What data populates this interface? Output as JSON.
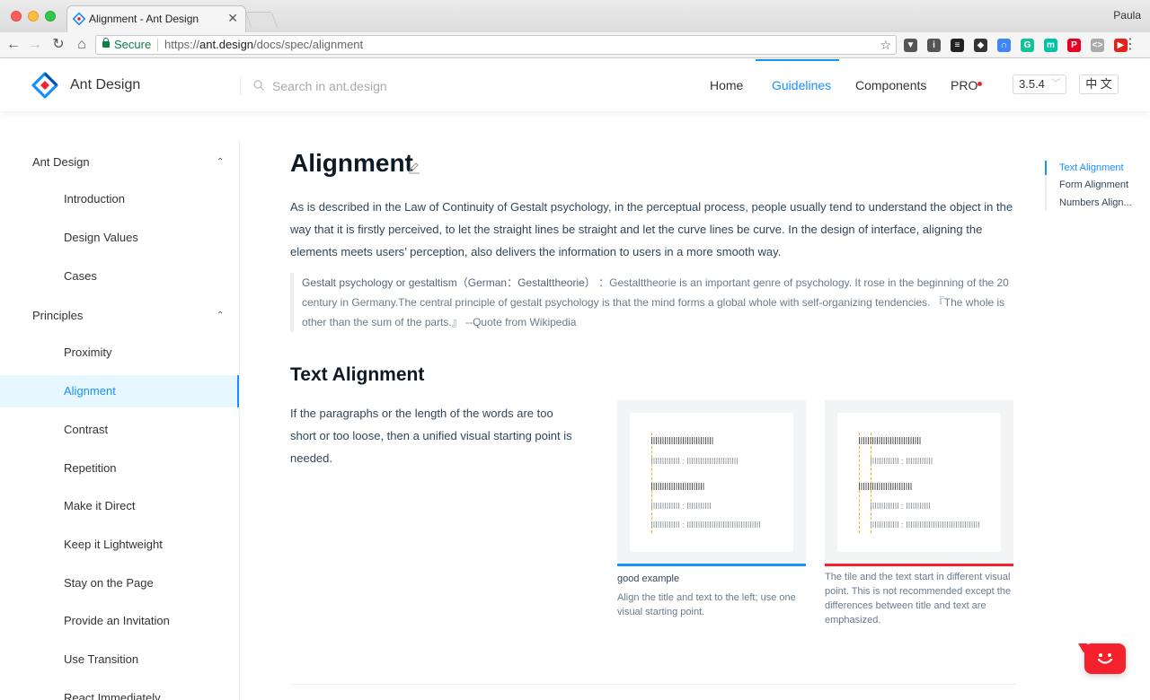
{
  "browser": {
    "tab_title": "Alignment - Ant Design",
    "tab_close": "✕",
    "profile": "Paula",
    "secure_label": "Secure",
    "url_scheme": "https://",
    "url_host": "ant.design",
    "url_path": "/docs/spec/alignment",
    "bookmark_star": "☆",
    "back": "←",
    "forward": "→",
    "reload": "↻",
    "home": "⌂",
    "menu": "⋮",
    "extensions": [
      {
        "name": "pocket-icon",
        "color": "#555555",
        "glyph": "▼"
      },
      {
        "name": "info-icon",
        "color": "#555555",
        "glyph": "i"
      },
      {
        "name": "buffer-icon",
        "color": "#222222",
        "glyph": "≡"
      },
      {
        "name": "shield-icon",
        "color": "#333333",
        "glyph": "◆"
      },
      {
        "name": "rainbow-icon",
        "color": "#4285f4",
        "glyph": "∩"
      },
      {
        "name": "grammarly-icon",
        "color": "#15c39a",
        "glyph": "G"
      },
      {
        "name": "m-icon",
        "color": "#00c4a7",
        "glyph": "m"
      },
      {
        "name": "pinterest-icon",
        "color": "#e60023",
        "glyph": "P"
      },
      {
        "name": "code-icon",
        "color": "#aaaaaa",
        "glyph": "<>"
      },
      {
        "name": "youtube-icon",
        "color": "#e62117",
        "glyph": "▶"
      }
    ]
  },
  "header": {
    "logo_text": "Ant Design",
    "search_placeholder": "Search in ant.design",
    "menu": [
      "Home",
      "Guidelines",
      "Components",
      "PRO"
    ],
    "active_menu": "Guidelines",
    "version": "3.5.4",
    "version_chevron": "﹀",
    "lang": "中 文"
  },
  "sidebar": {
    "groups": [
      {
        "label": "Ant Design",
        "caret": "⌃"
      },
      {
        "label": "Principles",
        "caret": "⌃"
      }
    ],
    "group1_items": [
      "Introduction",
      "Design Values",
      "Cases"
    ],
    "group2_items": [
      "Proximity",
      "Alignment",
      "Contrast",
      "Repetition",
      "Make it Direct",
      "Keep it Lightweight",
      "Stay on the Page",
      "Provide an Invitation",
      "Use Transition",
      "React Immediately"
    ],
    "active_item": "Alignment"
  },
  "content": {
    "title": "Alignment",
    "intro": "As is described in the Law of Continuity of Gestalt psychology, in the perceptual process, people usually tend to understand the object in the way that it is firstly perceived, to let the straight lines be straight and let the curve lines be curve. In the design of interface, aligning the elements meets users’ perception, also delivers the information to users in a more smooth way.",
    "quote_term": "Gestalt psychology or gestaltism（German：Gestalttheorie）",
    "quote_body": "：Gestalttheorie is an important genre of psychology. It rose in the beginning of the 20 century in Germany.The central principle of gestalt psychology is that the mind forms a global whole with self-organizing tendencies. 『The whole is other than the sum of the parts.』 --Quote from Wikipedia",
    "section_title": "Text Alignment",
    "section_para": "If the paragraphs or the length of the words are too short or too loose, then a unified visual starting point is needed.",
    "good_title": "good example",
    "good_caption": "Align the title and text to the left; use one visual starting point.",
    "bad_caption": "The tile and the text start in different visual point. This is not recommended except the differences between title and text are emphasized.",
    "colon": ":"
  },
  "toc": {
    "items": [
      "Text Alignment",
      "Form Alignment",
      "Numbers Align..."
    ],
    "active": "Text Alignment"
  },
  "colors": {
    "primary": "#1890ff",
    "good": "#1890ff",
    "bad": "#f5222d",
    "guide": "#faad14"
  }
}
